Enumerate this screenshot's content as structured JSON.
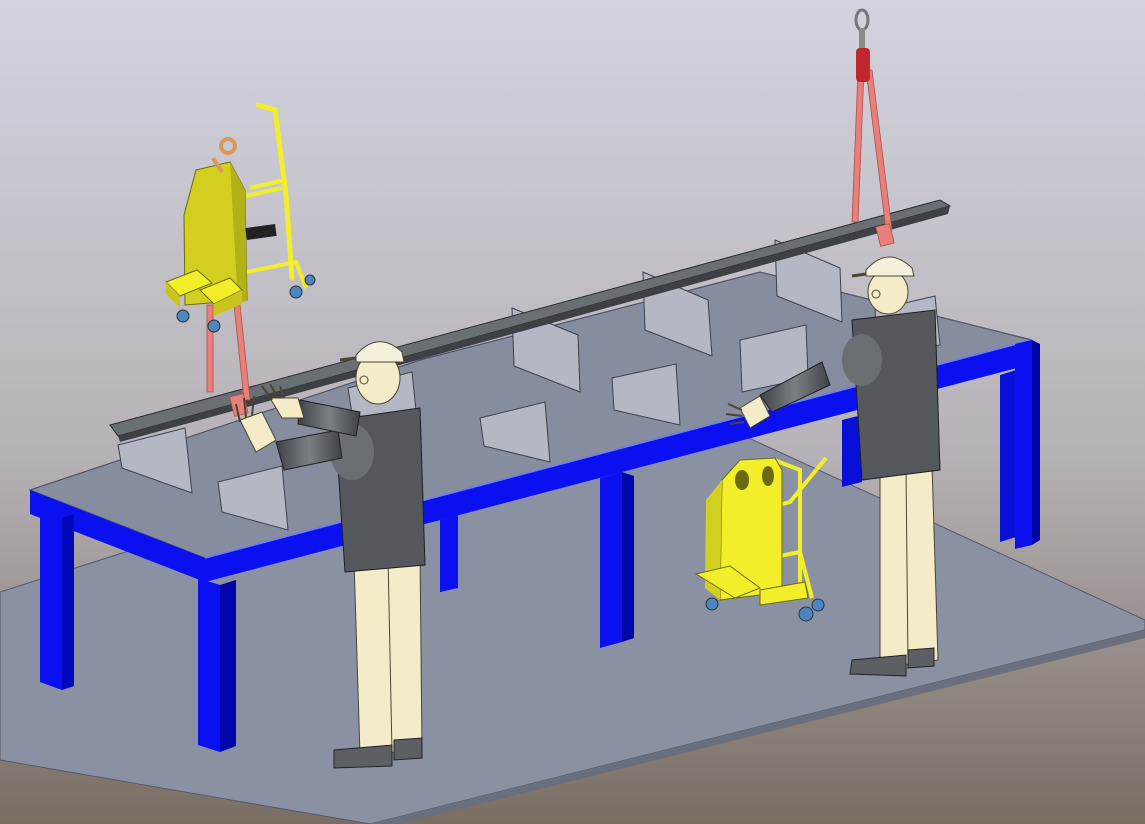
{
  "colors": {
    "background_top": "#cfcfdc",
    "background_bottom": "#7e7266",
    "floor_plate": "#8a91a3",
    "table_frame": "#0a10f0",
    "table_top": "#868d9f",
    "support_plates": "#aeb4c0",
    "steel_beam": "#5f6468",
    "lifting_straps": "#e8807a",
    "lifting_device": "#f2ef2a",
    "mannequin_skin": "#f4ecc8",
    "mannequin_shirt": "#565a5e"
  },
  "objects": {
    "table": "welding-table",
    "beam": "steel-i-beam",
    "supports": 10,
    "workers": 2,
    "lifting_trolleys": 2
  }
}
